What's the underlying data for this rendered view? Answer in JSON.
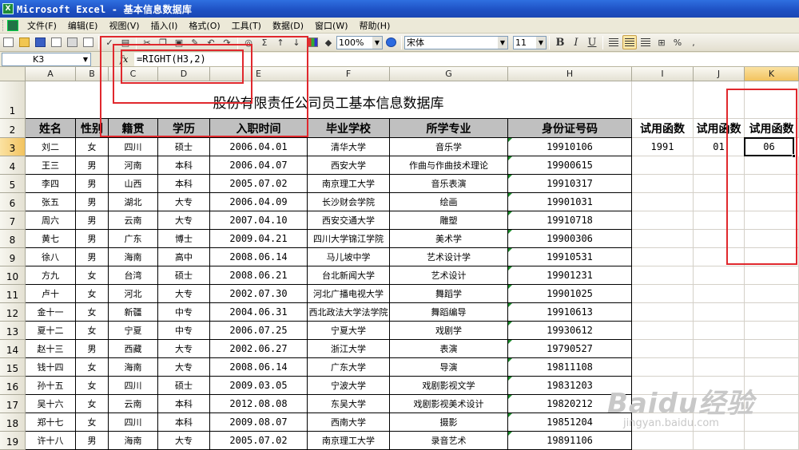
{
  "window": {
    "title": "Microsoft Excel - 基本信息数据库"
  },
  "menu": [
    "文件(F)",
    "编辑(E)",
    "视图(V)",
    "插入(I)",
    "格式(O)",
    "工具(T)",
    "数据(D)",
    "窗口(W)",
    "帮助(H)"
  ],
  "toolbar": {
    "zoom": "100%",
    "font_name": "宋体",
    "font_size": "11",
    "percent": "%",
    "comma": ","
  },
  "formula_bar": {
    "name_box": "K3",
    "fx": "fx",
    "formula": "=RIGHT(H3,2)"
  },
  "columns": [
    "A",
    "B",
    "C",
    "D",
    "E",
    "F",
    "G",
    "H",
    "I",
    "J",
    "K"
  ],
  "sheet": {
    "title": "股份有限责任公司员工基本信息数据库",
    "headers": [
      "姓名",
      "性别",
      "籍贯",
      "学历",
      "入职时间",
      "毕业学校",
      "所学专业",
      "身份证号码"
    ],
    "extra_headers": [
      "试用函数",
      "试用函数",
      "试用函数"
    ],
    "results": [
      "1991",
      "01",
      "06"
    ],
    "row_numbers": [
      "1",
      "2",
      "3",
      "4",
      "5",
      "6",
      "7",
      "8",
      "9",
      "10",
      "11",
      "12",
      "13",
      "14",
      "15",
      "16",
      "17",
      "18",
      "19"
    ],
    "rows": [
      [
        "刘二",
        "女",
        "四川",
        "硕士",
        "2006.04.01",
        "清华大学",
        "音乐学",
        "19910106"
      ],
      [
        "王三",
        "男",
        "河南",
        "本科",
        "2006.04.07",
        "西安大学",
        "作曲与作曲技术理论",
        "19900615"
      ],
      [
        "李四",
        "男",
        "山西",
        "本科",
        "2005.07.02",
        "南京理工大学",
        "音乐表演",
        "19910317"
      ],
      [
        "张五",
        "男",
        "湖北",
        "大专",
        "2006.04.09",
        "长沙财会学院",
        "绘画",
        "19901031"
      ],
      [
        "周六",
        "男",
        "云南",
        "大专",
        "2007.04.10",
        "西安交通大学",
        "雕塑",
        "19910718"
      ],
      [
        "黄七",
        "男",
        "广东",
        "博士",
        "2009.04.21",
        "四川大学锦江学院",
        "美术学",
        "19900306"
      ],
      [
        "徐八",
        "男",
        "海南",
        "高中",
        "2008.06.14",
        "马儿坡中学",
        "艺术设计学",
        "19910531"
      ],
      [
        "方九",
        "女",
        "台湾",
        "硕士",
        "2008.06.21",
        "台北新闻大学",
        "艺术设计",
        "19901231"
      ],
      [
        "卢十",
        "女",
        "河北",
        "大专",
        "2002.07.30",
        "河北广播电视大学",
        "舞蹈学",
        "19901025"
      ],
      [
        "金十一",
        "女",
        "新疆",
        "中专",
        "2004.06.31",
        "西北政法大学法学院",
        "舞蹈编导",
        "19910613"
      ],
      [
        "夏十二",
        "女",
        "宁夏",
        "中专",
        "2006.07.25",
        "宁夏大学",
        "戏剧学",
        "19930612"
      ],
      [
        "赵十三",
        "男",
        "西藏",
        "大专",
        "2002.06.27",
        "浙江大学",
        "表演",
        "19790527"
      ],
      [
        "钱十四",
        "女",
        "海南",
        "大专",
        "2008.06.14",
        "广东大学",
        "导演",
        "19811108"
      ],
      [
        "孙十五",
        "女",
        "四川",
        "硕士",
        "2009.03.05",
        "宁波大学",
        "戏剧影视文学",
        "19831203"
      ],
      [
        "吴十六",
        "女",
        "云南",
        "本科",
        "2012.08.08",
        "东吴大学",
        "戏剧影视美术设计",
        "19820212"
      ],
      [
        "郑十七",
        "女",
        "四川",
        "本科",
        "2009.08.07",
        "西南大学",
        "摄影",
        "19851204"
      ],
      [
        "许十八",
        "男",
        "海南",
        "大专",
        "2005.07.02",
        "南京理工大学",
        "录音艺术",
        "19891106"
      ]
    ]
  },
  "watermark": {
    "brand": "Baidu经验",
    "url": "jingyan.baidu.com"
  },
  "colors": {
    "titlebar": "#1d4fc2",
    "header_fill": "#c0c0c0",
    "annotation": "#e0282d",
    "selected_header": "#f2c35f"
  }
}
